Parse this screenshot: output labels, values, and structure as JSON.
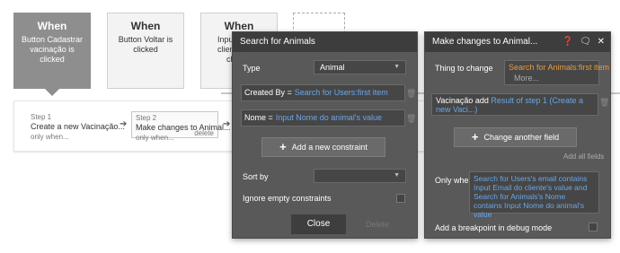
{
  "events": [
    {
      "title": "When",
      "desc": "Button Cadastrar vacinação is clicked"
    },
    {
      "title": "When",
      "desc": "Button Voltar is clicked"
    },
    {
      "title": "When",
      "desc_1": "Inpu",
      "desc_2": "client",
      "desc_3": "ch"
    }
  ],
  "steps": [
    {
      "num": "Step 1",
      "name": "Create a new Vacinação...",
      "cond": "only when..."
    },
    {
      "num": "Step 2",
      "name": "Make changes to Animal...",
      "cond": "only when...",
      "delete": "delete"
    }
  ],
  "search_panel": {
    "title": "Search for Animals",
    "type_label": "Type",
    "type_value": "Animal",
    "constraints": [
      {
        "label": "Created By =",
        "value": "Search for Users:first item"
      },
      {
        "label": "Nome =",
        "value": "Input Nome do animal's value"
      }
    ],
    "add_constraint": "Add a new constraint",
    "sort_label": "Sort by",
    "sort_value": "",
    "ignore_label": "Ignore empty constraints",
    "close": "Close",
    "delete": "Delete"
  },
  "changes_panel": {
    "title": "Make changes to Animal...",
    "icons": [
      "help-icon",
      "comment-icon",
      "close-icon"
    ],
    "thing_label": "Thing to change",
    "thing_value": "Search for Animals:first item",
    "thing_more": "More...",
    "field_name": "Vacinação add",
    "field_value": "Result of step 1 (Create a new Vaci...)",
    "change_field": "Change another field",
    "add_all": "Add all fields",
    "only_when_label": "Only when",
    "only_when_value": "Search for Users's email contains Input Email do cliente's value and Search for Animals's Nome contains Input Nome do animal's value",
    "breakpoint": "Add a breakpoint in debug mode"
  },
  "colors": {
    "panel": "#595959",
    "header": "#3d3d3d",
    "accent_blue": "#6aa6e8",
    "accent_orange": "#e89a3c"
  }
}
